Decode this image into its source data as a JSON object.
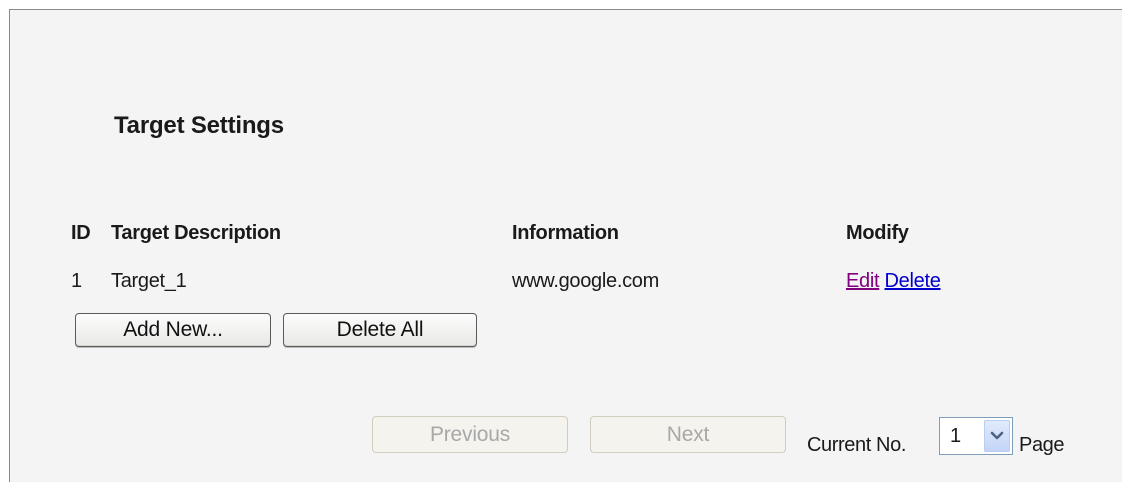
{
  "page": {
    "title": "Target Settings"
  },
  "table": {
    "headers": {
      "id": "ID",
      "description": "Target Description",
      "information": "Information",
      "modify": "Modify"
    },
    "rows": [
      {
        "id": "1",
        "description": "Target_1",
        "information": "www.google.com",
        "edit_label": "Edit",
        "delete_label": "Delete"
      }
    ]
  },
  "actions": {
    "add_new_label": "Add New...",
    "delete_all_label": "Delete All"
  },
  "pager": {
    "previous_label": "Previous",
    "next_label": "Next",
    "current_no_label": "Current No.",
    "current_page": "1",
    "page_suffix": "Page"
  },
  "colors": {
    "visited_link": "#800080",
    "link": "#0000cc",
    "panel_bg": "#f4f4f4"
  },
  "icons": {
    "select_arrow": "chevron-down-icon"
  }
}
